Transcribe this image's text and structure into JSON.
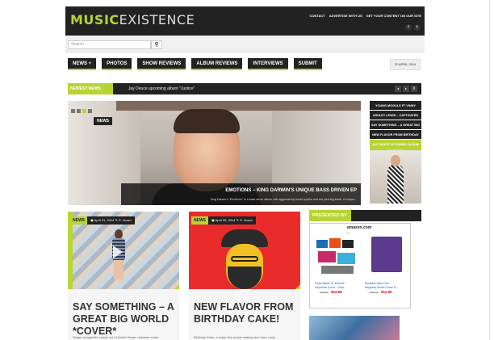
{
  "header": {
    "logo_bold": "MUSIC",
    "logo_thin": "EXISTENCE",
    "links": [
      "CONTACT",
      "ADVERTISE WITH US",
      "GET YOUR CONTENT ON OUR SITE"
    ],
    "social": [
      {
        "icon": "facebook-icon",
        "glyph": "f"
      },
      {
        "icon": "twitter-icon",
        "glyph": "t"
      }
    ]
  },
  "search": {
    "placeholder": "Search ...",
    "button_icon": "search-icon",
    "button_glyph": "⚲"
  },
  "nav": {
    "items": [
      "NEWS +",
      "PHOTOS",
      "SHOW REVIEWS",
      "ALBUM REVIEWS",
      "INTERVIEWS",
      "SUBMIT"
    ],
    "date": "22 APRIL 2014"
  },
  "ticker": {
    "label": "NEWEST NEWS",
    "text": "Jay Deuce upcoming album \"Justice\"",
    "arrows": [
      "◂",
      "▸",
      "Ⅱ"
    ]
  },
  "slider": {
    "tag": "NEWS",
    "caption_title": "EMOTIONS – KING DARWIN'S UNIQUE BASS DRIVEN EP",
    "caption_text": "King Darwin's \"Emotions\" is a bass driver album with aggressively tuned synths and ear piercing leads. A unique..."
  },
  "sidebar": {
    "items": [
      "YOUNG MOGULS FT VINNY",
      "ASHLEY LEWIS – CAPTIVATED",
      "SAY SOMETHING – A GREAT BIG",
      "NEW FLAVOR FROM BIRTHDAY",
      "JAY DEUCE UPCOMING ALBUM \"JUSTICE\""
    ]
  },
  "posts": [
    {
      "tag": "NEWS",
      "date": "April 21, 2014",
      "author": "S. Vozzo",
      "title": "SAY SOMETHING – A GREAT BIG WORLD *COVER*",
      "excerpt": "Singer-songwriter Lamar ool of Austin Texas, releases cover"
    },
    {
      "tag": "NEWS",
      "date": "April 20, 2014",
      "author": "S. Vozzo",
      "title": "NEW FLAVOR FROM BIRTHDAY CAKE!",
      "excerpt": "Birthday Cake, a super two music making duo form Long"
    }
  ],
  "presented": {
    "label": "PRESENTED BY",
    "ad_logo": "amazon",
    "ad_logo_suffix": ".com",
    "products": [
      {
        "caption": "Finite Blade S1 iPad Air",
        "caption2": "Keyboard Cover - Ultra...",
        "old_price": "$49.99",
        "price": "$24.99"
      },
      {
        "caption": "Bestable Ultra Thin",
        "caption2": "Magnetic Smart Cover S...",
        "old_price": "$39.99",
        "price": "$11.90"
      }
    ]
  },
  "colors": {
    "accent": "#b7d433",
    "dark": "#222222"
  }
}
